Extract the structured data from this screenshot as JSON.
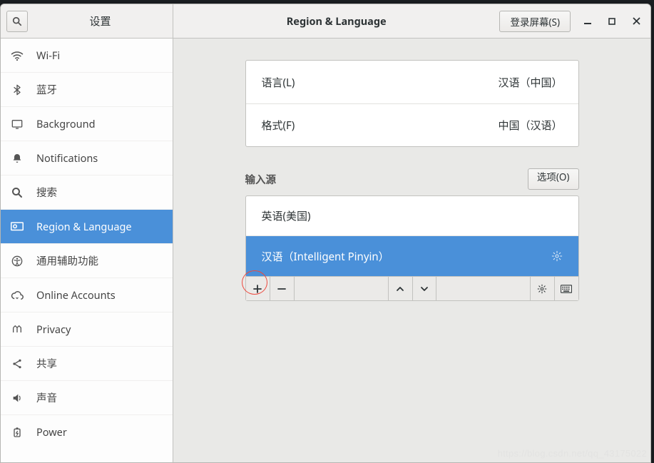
{
  "titlebar": {
    "settings_label": "设置",
    "panel_title": "Region & Language",
    "login_screen_label": "登录屏幕(S)"
  },
  "sidebar": {
    "items": [
      {
        "id": "wifi",
        "label": "Wi-Fi",
        "selected": false
      },
      {
        "id": "bluetooth",
        "label": "蓝牙",
        "selected": false
      },
      {
        "id": "background",
        "label": "Background",
        "selected": false
      },
      {
        "id": "notifications",
        "label": "Notifications",
        "selected": false
      },
      {
        "id": "search",
        "label": "搜索",
        "selected": false
      },
      {
        "id": "region",
        "label": "Region & Language",
        "selected": true
      },
      {
        "id": "universal",
        "label": "通用辅助功能",
        "selected": false
      },
      {
        "id": "online",
        "label": "Online Accounts",
        "selected": false
      },
      {
        "id": "privacy",
        "label": "Privacy",
        "selected": false
      },
      {
        "id": "sharing",
        "label": "共享",
        "selected": false
      },
      {
        "id": "sound",
        "label": "声音",
        "selected": false
      },
      {
        "id": "power",
        "label": "Power",
        "selected": false
      }
    ]
  },
  "settings_rows": {
    "language_label": "语言(L)",
    "language_value": "汉语（中国）",
    "formats_label": "格式(F)",
    "formats_value": "中国（汉语）"
  },
  "input_sources": {
    "section_title": "输入源",
    "options_label": "选项(O)",
    "items": [
      {
        "label": "英语(美国)",
        "selected": false,
        "gear": false
      },
      {
        "label": "汉语（Intelligent Pinyin）",
        "selected": true,
        "gear": true
      }
    ]
  },
  "watermark": "https://blog.csdn.net/qq_43175022"
}
